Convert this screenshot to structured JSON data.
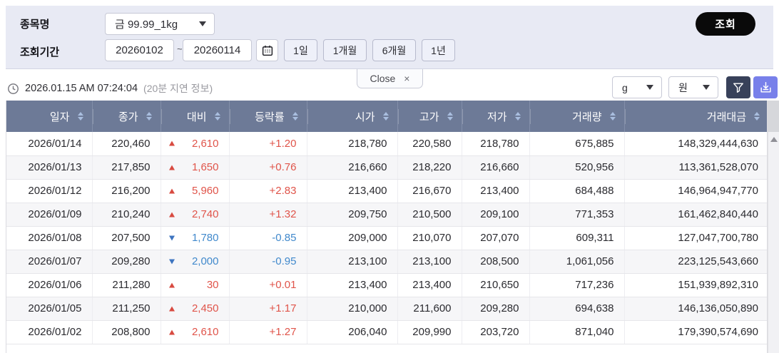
{
  "form": {
    "item_label": "종목명",
    "item_value": "금 99.99_1kg",
    "period_label": "조회기간",
    "date_from": "20260102",
    "range_separator": "~",
    "date_to": "20260114",
    "period_buttons": [
      "1일",
      "1개월",
      "6개월",
      "1년"
    ],
    "search_button": "조회"
  },
  "tab": {
    "label": "Close",
    "close_glyph": "×"
  },
  "status_bar": {
    "timestamp": "2026.01.15 AM 07:24:04",
    "delay_note": "(20분 지연 정보)"
  },
  "unit_controls": {
    "weight_unit": "g",
    "currency_unit": "원"
  },
  "table": {
    "columns": [
      "일자",
      "종가",
      "대비",
      "등락률",
      "시가",
      "고가",
      "저가",
      "거래량",
      "거래대금"
    ],
    "rows": [
      {
        "date": "2026/01/14",
        "close": "220,460",
        "direction": "up",
        "change": "2,610",
        "rate": "+1.20",
        "open": "218,780",
        "high": "220,580",
        "low": "218,780",
        "volume": "675,885",
        "amount": "148,329,444,630"
      },
      {
        "date": "2026/01/13",
        "close": "217,850",
        "direction": "up",
        "change": "1,650",
        "rate": "+0.76",
        "open": "216,660",
        "high": "218,220",
        "low": "216,660",
        "volume": "520,956",
        "amount": "113,361,528,070"
      },
      {
        "date": "2026/01/12",
        "close": "216,200",
        "direction": "up",
        "change": "5,960",
        "rate": "+2.83",
        "open": "213,400",
        "high": "216,670",
        "low": "213,400",
        "volume": "684,488",
        "amount": "146,964,947,770"
      },
      {
        "date": "2026/01/09",
        "close": "210,240",
        "direction": "up",
        "change": "2,740",
        "rate": "+1.32",
        "open": "209,750",
        "high": "210,500",
        "low": "209,100",
        "volume": "771,353",
        "amount": "161,462,840,440"
      },
      {
        "date": "2026/01/08",
        "close": "207,500",
        "direction": "down",
        "change": "1,780",
        "rate": "-0.85",
        "open": "209,000",
        "high": "210,070",
        "low": "207,070",
        "volume": "609,311",
        "amount": "127,047,700,780"
      },
      {
        "date": "2026/01/07",
        "close": "209,280",
        "direction": "down",
        "change": "2,000",
        "rate": "-0.95",
        "open": "213,100",
        "high": "213,100",
        "low": "208,500",
        "volume": "1,061,056",
        "amount": "223,125,543,660"
      },
      {
        "date": "2026/01/06",
        "close": "211,280",
        "direction": "up",
        "change": "30",
        "rate": "+0.01",
        "open": "213,400",
        "high": "213,400",
        "low": "210,650",
        "volume": "717,236",
        "amount": "151,939,892,310"
      },
      {
        "date": "2026/01/05",
        "close": "211,250",
        "direction": "up",
        "change": "2,450",
        "rate": "+1.17",
        "open": "210,000",
        "high": "211,600",
        "low": "209,280",
        "volume": "694,638",
        "amount": "146,136,050,890"
      },
      {
        "date": "2026/01/02",
        "close": "208,800",
        "direction": "up",
        "change": "2,610",
        "rate": "+1.27",
        "open": "206,040",
        "high": "209,990",
        "low": "203,720",
        "volume": "871,040",
        "amount": "179,390,574,690"
      }
    ]
  },
  "colors": {
    "up_text": "#e0544a",
    "up_triangle": "#d84a40",
    "down_text": "#4189cc",
    "down_triangle": "#3d74c0",
    "header_bg": "#6d7a97",
    "form_bg": "#e8eaf4",
    "search_button_bg": "#0a0a0a",
    "filter_button_bg": "#38415a",
    "download_button_bg": "#7880ea"
  }
}
